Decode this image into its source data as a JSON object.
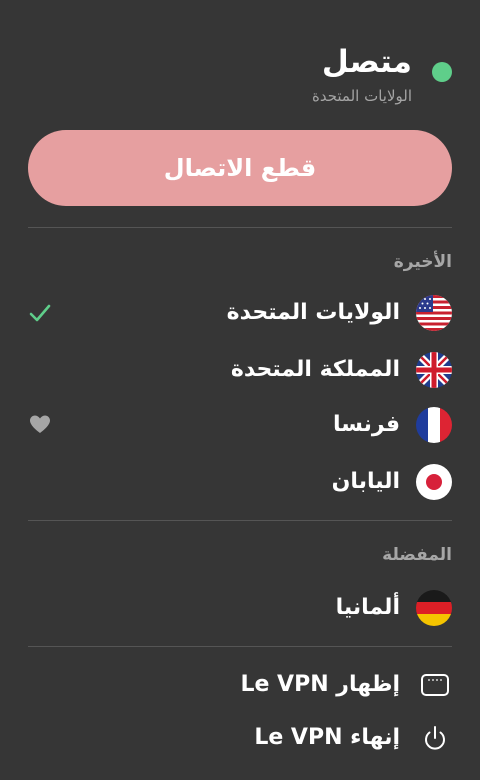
{
  "status": {
    "title": "متصل",
    "location": "الولايات المتحدة",
    "dot_color": "#5fce8a"
  },
  "disconnect_button": {
    "label": "قطع الاتصال",
    "color": "#e69fa0"
  },
  "recent": {
    "label": "الأخيرة",
    "items": [
      {
        "name": "الولايات المتحدة",
        "flag": "us-flag-icon",
        "trailing": "check-icon",
        "connected": true
      },
      {
        "name": "المملكة المتحدة",
        "flag": "uk-flag-icon",
        "trailing": ""
      },
      {
        "name": "فرنسا",
        "flag": "france-flag-icon",
        "trailing": "heart-icon"
      },
      {
        "name": "اليابان",
        "flag": "japan-flag-icon",
        "trailing": ""
      }
    ]
  },
  "favorites": {
    "label": "المفضلة",
    "items": [
      {
        "name": "ألمانيا",
        "flag": "germany-flag-icon"
      }
    ]
  },
  "actions": {
    "show_vpn": {
      "label": "إظهار Le VPN",
      "icon": "window-icon"
    },
    "quit_vpn": {
      "label": "إنهاء Le VPN",
      "icon": "power-icon"
    }
  },
  "colors": {
    "background": "#363636",
    "check": "#5fce8a",
    "muted": "#a6a6a6"
  }
}
